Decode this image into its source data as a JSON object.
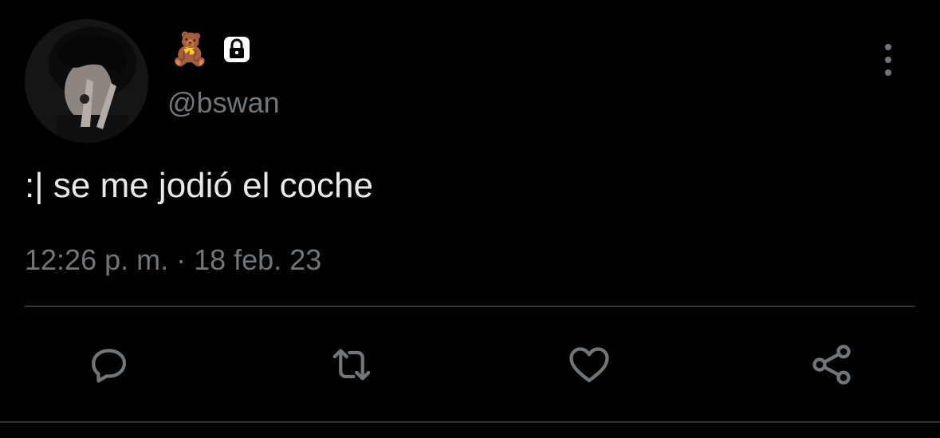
{
  "tweet": {
    "avatar_icon": "profile-photo",
    "badges": {
      "emoji": "🧸",
      "lock_icon": "lock-icon"
    },
    "handle": "@bswan",
    "text": ":| se me jodió el coche",
    "timestamp": "12:26 p. m. · 18 feb. 23",
    "more_icon": "more-vertical-icon"
  },
  "actions": [
    {
      "icon": "reply-icon"
    },
    {
      "icon": "retweet-icon"
    },
    {
      "icon": "like-icon"
    },
    {
      "icon": "share-icon"
    }
  ],
  "colors": {
    "background": "#000000",
    "text": "#e7e9ea",
    "muted": "#71767b",
    "divider": "#2f3336"
  }
}
